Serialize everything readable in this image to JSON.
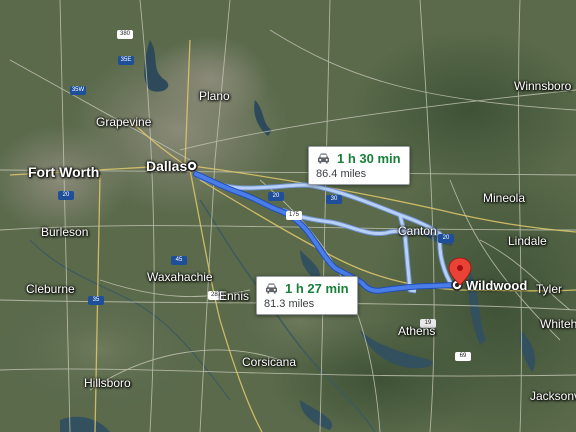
{
  "map": {
    "colors": {
      "route_primary": "#4a7de8",
      "route_primary_outline": "#1f4fb8",
      "route_alternate": "#a9c6f5",
      "duration_text": "#188038",
      "destination_pin": "#ea4335"
    },
    "cities": [
      {
        "id": "fort-worth",
        "label": "Fort Worth",
        "class": "major"
      },
      {
        "id": "dallas",
        "label": "Dallas",
        "class": "major"
      },
      {
        "id": "plano",
        "label": "Plano",
        "class": "mid"
      },
      {
        "id": "grapevine",
        "label": "Grapevine",
        "class": "mid"
      },
      {
        "id": "burleson",
        "label": "Burleson",
        "class": "mid"
      },
      {
        "id": "cleburne",
        "label": "Cleburne",
        "class": "mid"
      },
      {
        "id": "waxahachie",
        "label": "Waxahachie",
        "class": "mid"
      },
      {
        "id": "ennis",
        "label": "Ennis",
        "class": "mid"
      },
      {
        "id": "corsicana",
        "label": "Corsicana",
        "class": "mid"
      },
      {
        "id": "hillsboro",
        "label": "Hillsboro",
        "class": "mid"
      },
      {
        "id": "athens",
        "label": "Athens",
        "class": "mid"
      },
      {
        "id": "canton",
        "label": "Canton",
        "class": "mid"
      },
      {
        "id": "mineola",
        "label": "Mineola",
        "class": "mid"
      },
      {
        "id": "lindale",
        "label": "Lindale",
        "class": "mid"
      },
      {
        "id": "tyler",
        "label": "Tyler",
        "class": "mid"
      },
      {
        "id": "whitehouse",
        "label": "Whiteh",
        "class": "mid"
      },
      {
        "id": "jacksonville",
        "label": "Jacksonv",
        "class": "mid"
      },
      {
        "id": "winnsboro",
        "label": "Winnsboro",
        "class": "mid"
      }
    ],
    "origin": {
      "label": "Dallas"
    },
    "destination": {
      "label": "Wildwood"
    },
    "routes": [
      {
        "id": "alternate",
        "duration": "1 h 30 min",
        "distance": "86.4 miles",
        "selected": false
      },
      {
        "id": "primary",
        "duration": "1 h 27 min",
        "distance": "81.3 miles",
        "selected": true
      }
    ],
    "shields": [
      {
        "id": "s-380",
        "text": "380",
        "kind": "us"
      },
      {
        "id": "s-35e",
        "text": "35E",
        "kind": "i"
      },
      {
        "id": "s-35w",
        "text": "35W",
        "kind": "i"
      },
      {
        "id": "s-20a",
        "text": "20",
        "kind": "i"
      },
      {
        "id": "s-20b",
        "text": "20",
        "kind": "i"
      },
      {
        "id": "s-20c",
        "text": "20",
        "kind": "i"
      },
      {
        "id": "s-175",
        "text": "175",
        "kind": "us"
      },
      {
        "id": "s-45",
        "text": "45",
        "kind": "i"
      },
      {
        "id": "s-287",
        "text": "287",
        "kind": "us"
      },
      {
        "id": "s-35",
        "text": "35",
        "kind": "i"
      },
      {
        "id": "s-19",
        "text": "19",
        "kind": "st"
      },
      {
        "id": "s-30",
        "text": "30",
        "kind": "i"
      },
      {
        "id": "s-69",
        "text": "69",
        "kind": "us"
      }
    ]
  }
}
